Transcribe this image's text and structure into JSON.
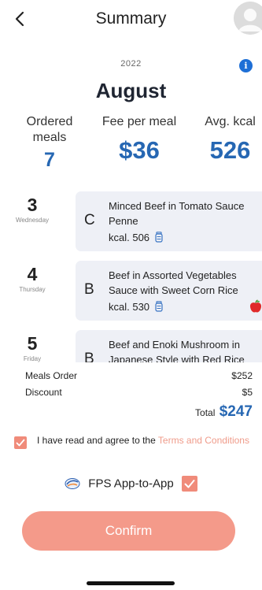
{
  "header": {
    "title": "Summary",
    "back_icon": "chevron-left-icon",
    "avatar_icon": "user-avatar-icon"
  },
  "period": {
    "year": "2022",
    "month": "August",
    "info_icon": "info-icon"
  },
  "stats": [
    {
      "label": "Ordered meals",
      "value": "7"
    },
    {
      "label": "Fee per meal",
      "value": "$36"
    },
    {
      "label": "Avg. kcal",
      "value": "526"
    }
  ],
  "meals": [
    {
      "day": "3",
      "weekday": "Wednesday",
      "set": "C",
      "name": "Minced Beef in Tomato Sauce Penne",
      "kcal": "kcal. 506",
      "apple": false
    },
    {
      "day": "4",
      "weekday": "Thursday",
      "set": "B",
      "name": "Beef in Assorted Vegetables Sauce with Sweet Corn Rice",
      "kcal": "kcal. 530",
      "apple": true
    },
    {
      "day": "5",
      "weekday": "Friday",
      "set": "B",
      "name": "Beef and Enoki Mushroom in Japanese Style with Red Rice",
      "kcal": "",
      "apple": false
    }
  ],
  "totals": {
    "meals_order_label": "Meals Order",
    "meals_order_value": "$252",
    "discount_label": "Discount",
    "discount_value": "$5",
    "total_label": "Total",
    "total_value": "$247"
  },
  "agreement": {
    "text": "I have read and agree to the ",
    "link": "Terms and Conditions",
    "checked": true
  },
  "payment": {
    "label": "FPS App-to-App",
    "checked": true
  },
  "confirm_label": "Confirm",
  "colors": {
    "accent_blue": "#2667b3",
    "accent_coral": "#f49a8a",
    "card_bg": "#eef0f6"
  }
}
